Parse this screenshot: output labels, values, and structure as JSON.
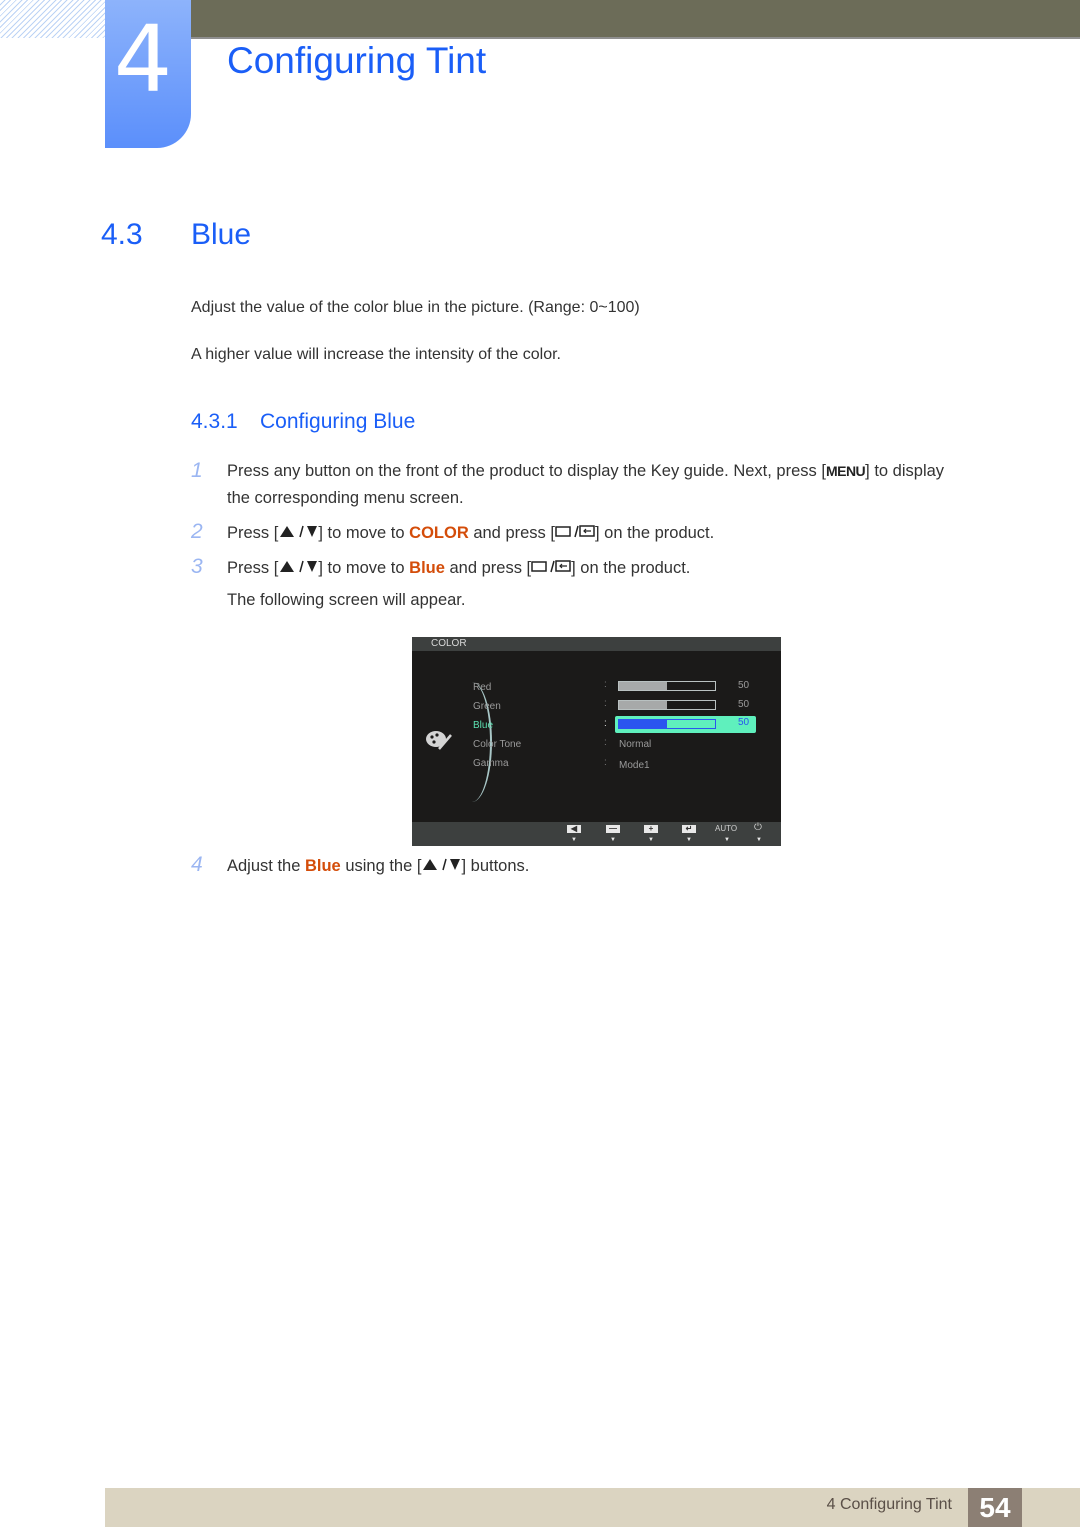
{
  "chapter": {
    "number": "4",
    "title": "Configuring Tint"
  },
  "section": {
    "number": "4.3",
    "title": "Blue"
  },
  "paragraphs": [
    "Adjust the value of the color blue in the picture. (Range: 0~100)",
    "A higher value will increase the intensity of the color."
  ],
  "subsection": {
    "number": "4.3.1",
    "title": "Configuring Blue"
  },
  "steps": [
    {
      "num": "1",
      "line1_a": "Press any button on the front of the product to display the Key guide. Next, press [",
      "menu_key": "MENU",
      "line1_b": "] to display",
      "line2": "the corresponding menu screen."
    },
    {
      "num": "2",
      "a": "Press [",
      "b": "] to move to ",
      "hl": "COLOR",
      "c": " and press [",
      "d": "] on the product."
    },
    {
      "num": "3",
      "a": "Press [",
      "b": "] to move to ",
      "hl": "Blue",
      "c": " and press [",
      "d": "] on the product.",
      "after": "The following screen will appear."
    },
    {
      "num": "4",
      "a": "Adjust the ",
      "hl": "Blue",
      "b": " using the [",
      "c": "] buttons."
    }
  ],
  "osd": {
    "header": "COLOR",
    "items": [
      {
        "label": "Red",
        "type": "slider",
        "value": 50,
        "value_text": "50"
      },
      {
        "label": "Green",
        "type": "slider",
        "value": 50,
        "value_text": "50"
      },
      {
        "label": "Blue",
        "type": "slider",
        "value": 50,
        "value_text": "50",
        "selected": true
      },
      {
        "label": "Color Tone",
        "type": "text",
        "value_text": "Normal"
      },
      {
        "label": "Gamma",
        "type": "text",
        "value_text": "Mode1"
      }
    ],
    "range_max": 100,
    "footer_buttons": [
      "left-arrow-icon",
      "minus-icon",
      "plus-icon",
      "enter-icon",
      "AUTO",
      "power-icon"
    ],
    "auto_label": "AUTO",
    "colon": ":"
  },
  "footer": {
    "label": "4 Configuring Tint",
    "page": "54"
  },
  "colors": {
    "accent_blue": "#1a5ef7",
    "highlight_orange": "#d44d0a",
    "osd_select": "#5ff0bd"
  }
}
